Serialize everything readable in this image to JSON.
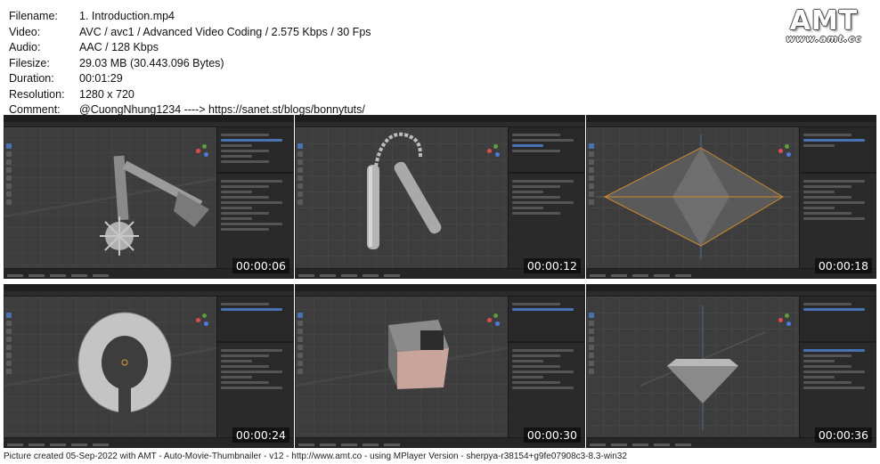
{
  "info": [
    {
      "label": "Filename:",
      "value": "1. Introduction.mp4"
    },
    {
      "label": "Video:",
      "value": "AVC / avc1 / Advanced Video Coding / 2.575 Kbps / 30 Fps"
    },
    {
      "label": "Audio:",
      "value": "AAC / 128 Kbps"
    },
    {
      "label": "Filesize:",
      "value": "29.03 MB (30.443.096 Bytes)"
    },
    {
      "label": "Duration:",
      "value": "00:01:29"
    },
    {
      "label": "Resolution:",
      "value": "1280 x 720"
    },
    {
      "label": "Comment:",
      "value": "@CuongNhung1234 ----> https://sanet.st/blogs/bonnytuts/"
    }
  ],
  "logo": {
    "main": "AMT",
    "sub": "www.amt.cc"
  },
  "thumbnails": [
    {
      "time": "00:00:06",
      "subject": "spiked mace on chain"
    },
    {
      "time": "00:00:12",
      "subject": "nunchaku"
    },
    {
      "time": "00:00:18",
      "subject": "double pyramid"
    },
    {
      "time": "00:00:24",
      "subject": "torus ring"
    },
    {
      "time": "00:00:30",
      "subject": "cube"
    },
    {
      "time": "00:00:36",
      "subject": "inverted cone"
    }
  ],
  "footer": "Picture created 05-Sep-2022 with AMT - Auto-Movie-Thumbnailer - v12 - http://www.amt.co - using MPlayer Version - sherpya-r38154+g9fe07908c3-8.3-win32",
  "colors": {
    "accent": "#4772b3",
    "viewport": "#3d3d3d",
    "panel": "#2a2a2a",
    "header": "#1e1e1e"
  }
}
